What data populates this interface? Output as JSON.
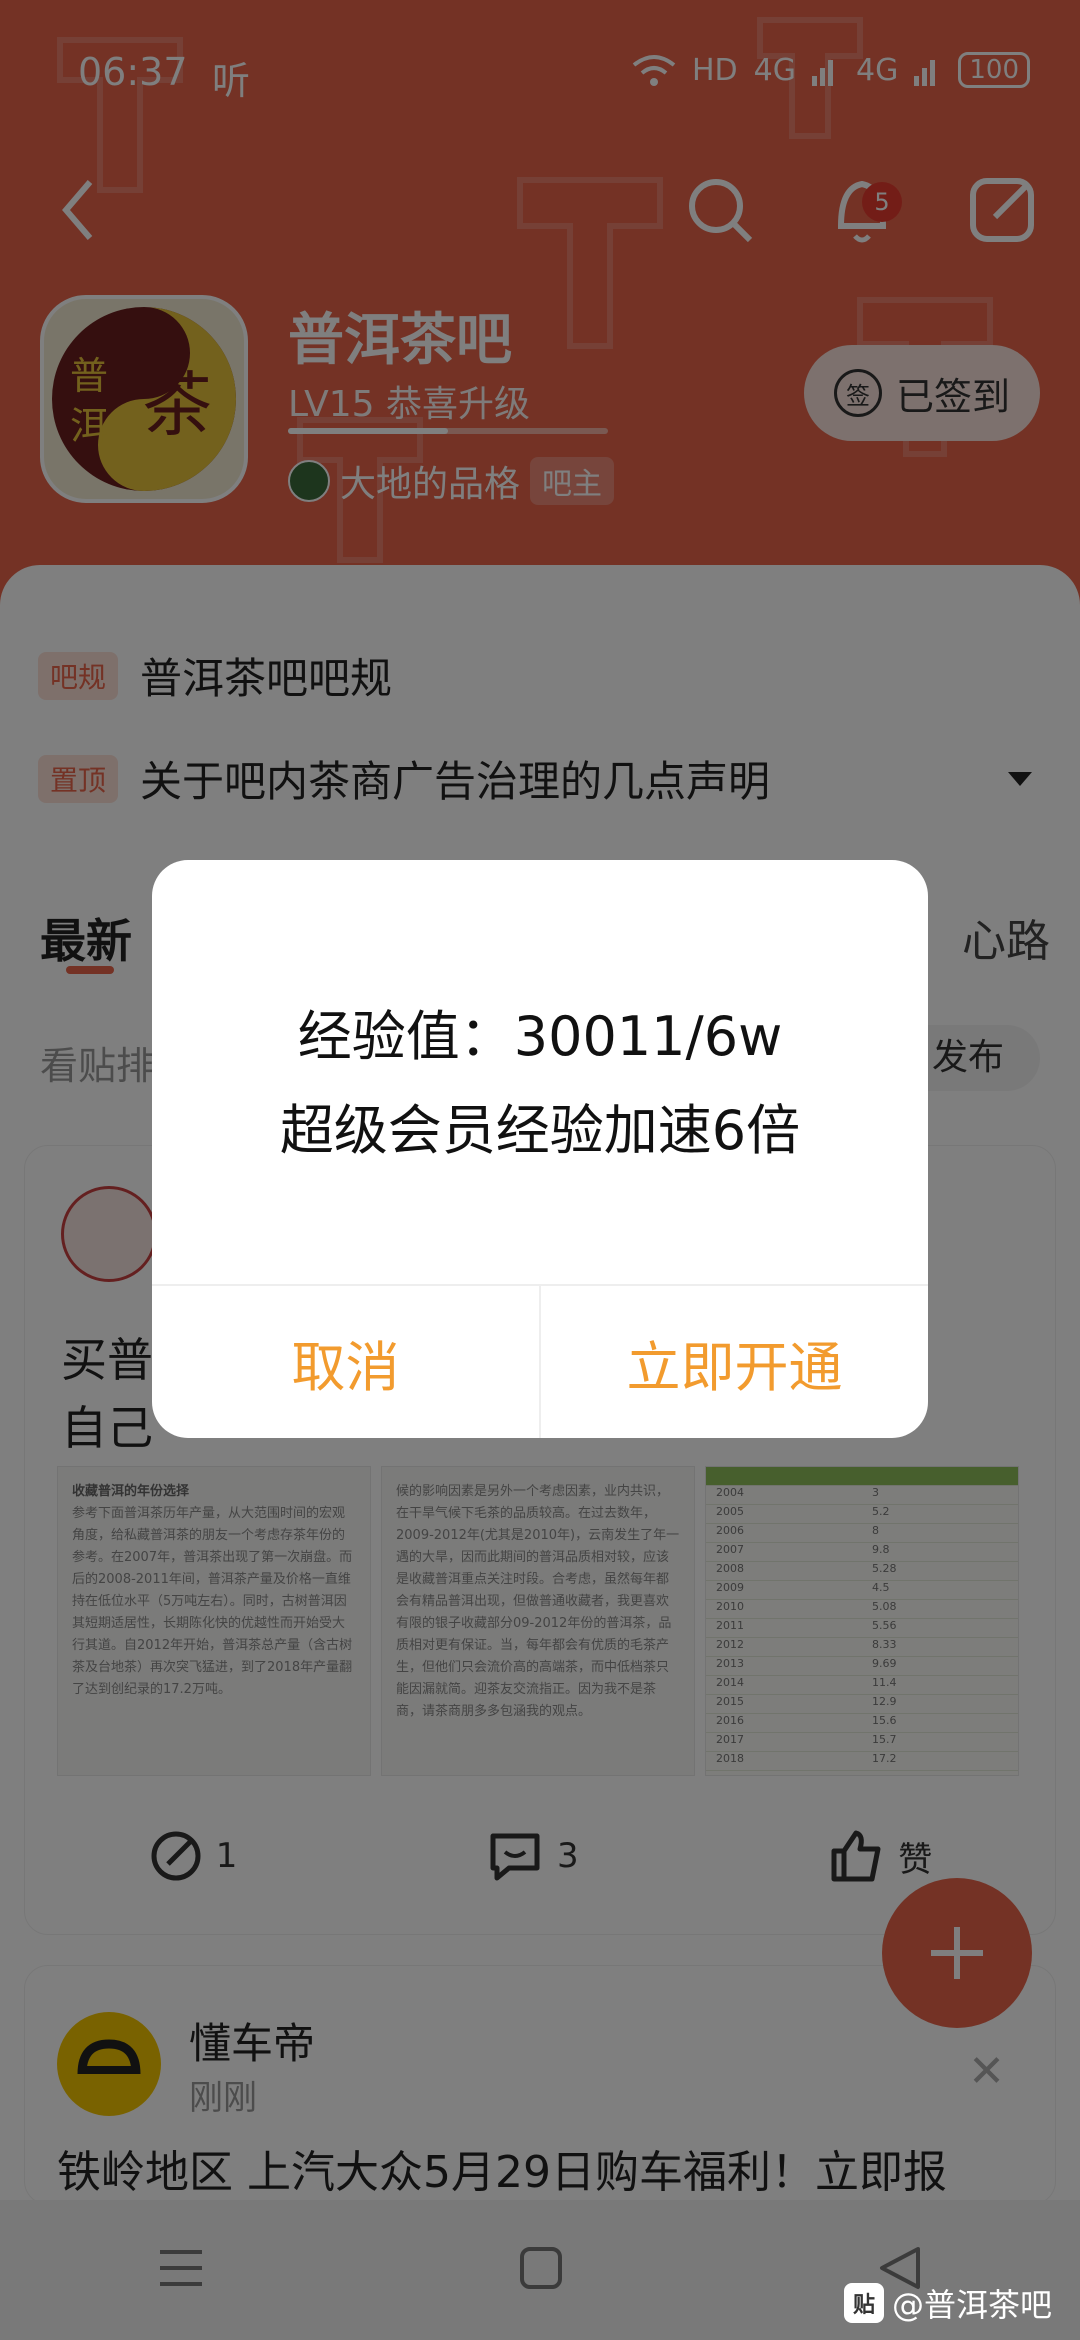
{
  "status_bar": {
    "time": "06:37",
    "app_indicator": "听",
    "network": "HD",
    "signal_1": "4G",
    "signal_2": "4G",
    "battery": "100"
  },
  "header": {
    "forum_name": "普洱茶吧",
    "level_text": "LV15 恭喜升级",
    "level_progress": 0.5,
    "owner_name": "大地的品格",
    "owner_role": "吧主",
    "sign_label": "已签到",
    "sign_icon_glyph": "签",
    "notification_count": "5",
    "logo_chars": [
      "普",
      "洱",
      "茶"
    ]
  },
  "rules": [
    {
      "tag": "吧规",
      "text": "普洱茶吧吧规"
    },
    {
      "tag": "置顶",
      "text": "关于吧内茶商广告治理的几点声明"
    }
  ],
  "tabs": {
    "latest": "最新",
    "right_label": "心路"
  },
  "sort": {
    "label": "看贴排",
    "publish": "发布"
  },
  "post": {
    "text_line1": "买普",
    "text_line2": "自己",
    "thumb1_title": "收藏普洱的年份选择",
    "thumb1_text": "参考下面普洱茶历年产量，从大范围时间的宏观角度，给私藏普洱茶的朋友一个考虑存茶年份的参考。在2007年，普洱茶出现了第一次崩盘。而后的2008-2011年间，普洱茶产量及价格一直维持在低位水平（5万吨左右）。同时，古树普洱因其短期适居性，长期陈化快的优越性而开始受大行其道。自2012年开始，普洱茶总产量（含古树茶及台地茶）再次突飞猛进，到了2018年产量翻了达到创纪录的17.2万吨。",
    "thumb2_text": "候的影响因素是另外一个考虑因素，业内共识，在干旱气候下毛茶的品质较高。在过去数年，2009-2012年(尤其是2010年)，云南发生了年一遇的大旱，因而此期间的普洱品质相对较，应该是收藏普洱重点关注时段。合考虑，虽然每年都会有精品普洱出现，但做普通收藏者，我更喜欢有限的银子收藏部分09-2012年份的普洱茶，品质相对更有保证。当，每年都会有优质的毛茶产生，但他们只会流价高的高端茶，而中低档茶只能因漏就简。迎茶友交流指正。因为我不是茶商，请茶商朋多多包涵我的观点。",
    "table_rows": [
      [
        "2004",
        "3"
      ],
      [
        "2005",
        "5.2"
      ],
      [
        "2006",
        "8"
      ],
      [
        "2007",
        "9.8"
      ],
      [
        "2008",
        "5.28"
      ],
      [
        "2009",
        "4.5"
      ],
      [
        "2010",
        "5.08"
      ],
      [
        "2011",
        "5.56"
      ],
      [
        "2012",
        "8.33"
      ],
      [
        "2013",
        "9.69"
      ],
      [
        "2014",
        "11.4"
      ],
      [
        "2015",
        "12.9"
      ],
      [
        "2016",
        "15.6"
      ],
      [
        "2017",
        "15.7"
      ],
      [
        "2018",
        "17.2"
      ]
    ],
    "share_count": "1",
    "comment_count": "3",
    "like_label": "赞"
  },
  "ad": {
    "name": "懂车帝",
    "time": "刚刚",
    "text": "铁岭地区 上汽大众5月29日购车福利！立即报"
  },
  "dialog": {
    "line1": "经验值：30011/6w",
    "line2": "超级会员经验加速6倍",
    "cancel": "取消",
    "confirm": "立即开通"
  },
  "watermark": {
    "logo": "贴",
    "text": "@普洱茶吧"
  },
  "colors": {
    "brand": "#e8654b",
    "dialog_button": "#f29b2e"
  }
}
